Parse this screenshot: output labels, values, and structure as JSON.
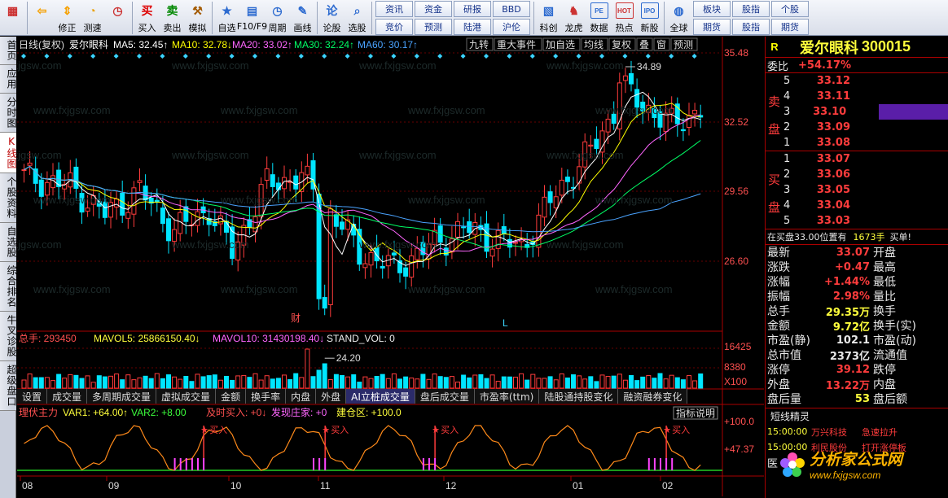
{
  "toolbar": {
    "items": [
      {
        "label": "",
        "icon": "home-grid-icon",
        "color": "#c33"
      },
      {
        "label": "",
        "icon": "back-arrow-icon",
        "color": "#f5a000"
      },
      {
        "label": "修正",
        "icon": "up-down-arrows-icon",
        "color": "#f5a000"
      },
      {
        "label": "测速",
        "icon": "stopwatch-icon",
        "color": "#e9a000"
      },
      {
        "label": "",
        "icon": "clock-icon",
        "color": "#c33"
      },
      {
        "label": "买入",
        "icon": "buy-icon",
        "glyph": "买",
        "color": "#d00"
      },
      {
        "label": "卖出",
        "icon": "sell-icon",
        "glyph": "卖",
        "color": "#080"
      },
      {
        "label": "模拟",
        "icon": "gavel-icon",
        "color": "#a35a00"
      },
      {
        "label": "自选",
        "icon": "watchlist-icon",
        "color": "#2d6bd0"
      },
      {
        "label": "F10/F9",
        "icon": "f10-icon",
        "color": "#2d6bd0"
      },
      {
        "label": "周期",
        "icon": "period-icon",
        "color": "#2d6bd0"
      },
      {
        "label": "画线",
        "icon": "pencil-icon",
        "color": "#2d6bd0"
      },
      {
        "label": "论股",
        "icon": "discuss-icon",
        "glyph": "论",
        "color": "#2d6bd0"
      },
      {
        "label": "选股",
        "icon": "magnifier-icon",
        "color": "#2d6bd0"
      }
    ],
    "grid1": [
      "资讯",
      "资金",
      "研报",
      "BBD",
      "竞价",
      "预测",
      "陆港",
      "沪伦"
    ],
    "items2": [
      {
        "label": "科创",
        "icon": "chart-icon",
        "color": "#2d6bd0"
      },
      {
        "label": "龙虎",
        "icon": "dragon-icon",
        "color": "#c33"
      },
      {
        "label": "数据",
        "icon": "pe-icon",
        "glyph": "PE",
        "color": "#2d6bd0"
      },
      {
        "label": "热点",
        "icon": "hot-icon",
        "glyph": "HOT",
        "color": "#c33"
      },
      {
        "label": "新股",
        "icon": "ipo-icon",
        "glyph": "IPO",
        "color": "#2d6bd0"
      },
      {
        "label": "全球",
        "icon": "globe-icon",
        "color": "#2d6bd0"
      }
    ],
    "grid2": [
      "板块",
      "股指",
      "个股",
      "期货",
      "股指",
      "期货"
    ]
  },
  "left_tabs": [
    "首页",
    "应用",
    "分时图",
    "K线图",
    "个股资料",
    "自选股",
    "综合排名",
    "牛叉诊股",
    "超级盘口"
  ],
  "chart_header": {
    "title": "日线(复权)",
    "name": "爱尔眼科",
    "ma5": "MA5: 32.45↑",
    "ma10": "MA10: 32.78↓",
    "ma20": "MA20: 33.02↑",
    "ma30": "MA30: 32.24↑",
    "ma60": "MA60: 30.17↑",
    "buttons": [
      "九转",
      "重大事件",
      "加自选",
      "均线",
      "复权",
      "叠",
      "窗",
      "预测"
    ]
  },
  "price_axis": [
    "35.48",
    "32.52",
    "29.56",
    "26.60"
  ],
  "annotations": {
    "high": "34.89",
    "low": "24.20",
    "cai": "财",
    "L": "L"
  },
  "volume_header": {
    "total": "总手: 293450",
    "mavol5": "MAVOL5: 25866150.40↓",
    "mavol10": "MAVOL10: 31430198.40↓",
    "stand": "STAND_VOL: 0"
  },
  "volume_axis": [
    "16425",
    "8380",
    "X100"
  ],
  "bottom_tabs": [
    "设置",
    "成交量",
    "多周期成交量",
    "虚拟成交量",
    "金额",
    "换手率",
    "内盘",
    "外盘",
    "AI立桩成交量",
    "盘后成交量",
    "市盈率(ttm)",
    "陆股通持股变化",
    "融资融券变化"
  ],
  "bottom_tabs_active": "AI立桩成交量",
  "indicator_header": {
    "name": "理伏主力",
    "var1": "VAR1: +64.00↑",
    "var2": "VAR2: +8.00",
    "buy": "及时买入: +0↓",
    "zhuang": "发现庄家: +0",
    "jiancang": "建仓区: +100.0",
    "help": "指标说明"
  },
  "indicator_axis": [
    "+100.0",
    "+47.37"
  ],
  "buy_label": "买入",
  "months": [
    "08",
    "09",
    "10",
    "11",
    "12",
    "01",
    "02"
  ],
  "quote": {
    "flag": "R",
    "name": "爱尔眼科",
    "code": "300015",
    "weibi_label": "委比",
    "weibi": "+54.17%",
    "sell_side_label": "卖盘",
    "buy_side_label": "买盘",
    "sell": [
      {
        "n": "5",
        "p": "33.12"
      },
      {
        "n": "4",
        "p": "33.11"
      },
      {
        "n": "3",
        "p": "33.10"
      },
      {
        "n": "2",
        "p": "33.09"
      },
      {
        "n": "1",
        "p": "33.08"
      }
    ],
    "buy": [
      {
        "n": "1",
        "p": "33.07"
      },
      {
        "n": "2",
        "p": "33.06"
      },
      {
        "n": "3",
        "p": "33.05"
      },
      {
        "n": "4",
        "p": "33.04"
      },
      {
        "n": "5",
        "p": "33.03"
      }
    ],
    "notice": "在买盘33.00位置有",
    "notice_qty": "1673手",
    "notice_tag": "买单!",
    "stats": [
      {
        "k": "最新",
        "v": "33.07",
        "k2": "开盘"
      },
      {
        "k": "涨跌",
        "v": "+0.47",
        "k2": "最高"
      },
      {
        "k": "涨幅",
        "v": "+1.44%",
        "k2": "最低"
      },
      {
        "k": "振幅",
        "v": "2.98%",
        "k2": "量比"
      },
      {
        "k": "总手",
        "v": "29.35万",
        "k2": "换手"
      },
      {
        "k": "金额",
        "v": "9.72亿",
        "k2": "换手(实)"
      },
      {
        "k": "市盈(静)",
        "v": "102.1",
        "k2": "市盈(动)"
      },
      {
        "k": "总市值",
        "v": "2373亿",
        "k2": "流通值"
      },
      {
        "k": "涨停",
        "v": "39.12",
        "k2": "跌停"
      },
      {
        "k": "外盘",
        "v": "13.22万",
        "k2": "内盘"
      },
      {
        "k": "盘后量",
        "v": "53",
        "k2": "盘后额"
      }
    ],
    "fast_title": "短线精灵",
    "fast": [
      {
        "t": "15:00:00",
        "n": "万兴科技",
        "e": "急速拉升"
      },
      {
        "t": "15:00:00",
        "n": "利民股份",
        "e": "打开涨停板"
      }
    ],
    "fast_bottom": "医"
  },
  "watermark": "分析家公式网",
  "watermark_url": "www.fxjgsw.com",
  "colors": {
    "up": "#ff3c3c",
    "down": "#00e5ff",
    "ma5": "#ffffff",
    "ma10": "#ffff00",
    "ma20": "#ff66ff",
    "ma30": "#00ff66",
    "ma60": "#4aa3ff"
  }
}
